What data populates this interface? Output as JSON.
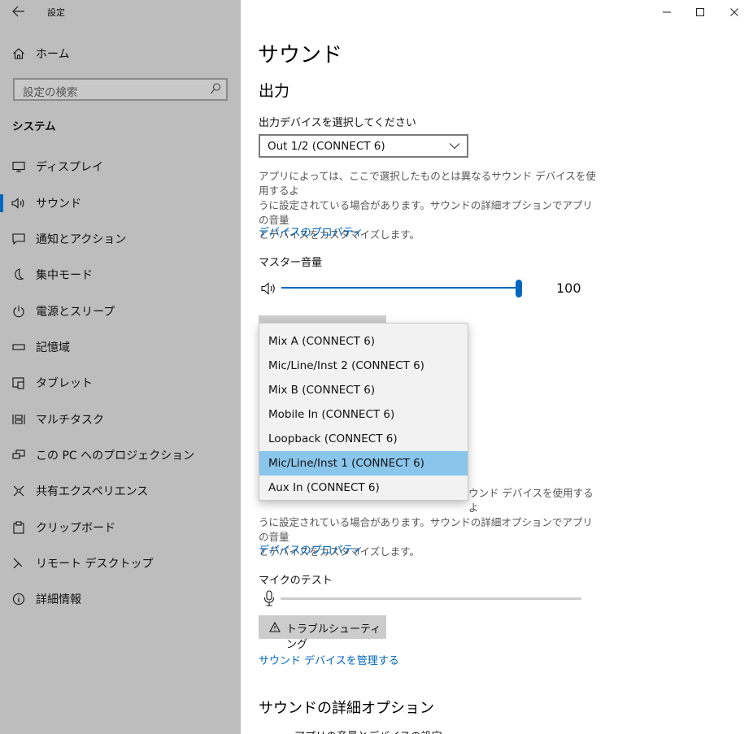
{
  "window": {
    "title": "設定",
    "controls": {
      "minimize": "—",
      "maximize": "☐",
      "close": "✕"
    }
  },
  "sidebar": {
    "home_label": "ホーム",
    "search_placeholder": "設定の検索",
    "section_label": "システム",
    "items": [
      {
        "label": "ディスプレイ",
        "icon": "display-icon"
      },
      {
        "label": "サウンド",
        "icon": "speaker-icon",
        "selected": true
      },
      {
        "label": "通知とアクション",
        "icon": "notification-icon"
      },
      {
        "label": "集中モード",
        "icon": "moon-icon"
      },
      {
        "label": "電源とスリープ",
        "icon": "power-icon"
      },
      {
        "label": "記憶域",
        "icon": "storage-icon"
      },
      {
        "label": "タブレット",
        "icon": "tablet-icon"
      },
      {
        "label": "マルチタスク",
        "icon": "multitask-icon"
      },
      {
        "label": "この PC へのプロジェクション",
        "icon": "projection-icon"
      },
      {
        "label": "共有エクスペリエンス",
        "icon": "shared-experience-icon"
      },
      {
        "label": "クリップボード",
        "icon": "clipboard-icon"
      },
      {
        "label": "リモート デスクトップ",
        "icon": "remote-desktop-icon"
      },
      {
        "label": "詳細情報",
        "icon": "info-icon"
      }
    ],
    "accent_color": "#0067c0"
  },
  "main": {
    "page_title": "サウンド",
    "output": {
      "heading": "出力",
      "select_label": "出力デバイスを選択してください",
      "selected_device": "Out 1/2 (CONNECT 6)",
      "description": "アプリによっては、ここで選択したものとは異なるサウンド デバイスを使用するように設定されている場合があります。サウンドの詳細オプションでアプリの音量とデバイスをカスタマイズします。",
      "desc_line1": "アプリによっては、ここで選択したものとは異なるサウンド デバイスを使用するよ",
      "desc_line2": "うに設定されている場合があります。サウンドの詳細オプションでアプリの音量",
      "desc_line3": "とデバイスをカスタマイズします。",
      "properties_link": "デバイスのプロパティ",
      "master_volume_label": "マスター音量",
      "volume_value": "100",
      "volume_level": 1.0
    },
    "input": {
      "dropdown_options": [
        "Mix A (CONNECT 6)",
        "Mic/Line/Inst 2 (CONNECT 6)",
        "Mix B (CONNECT 6)",
        "Mobile In (CONNECT 6)",
        "Loopback (CONNECT 6)",
        "Mic/Line/Inst 1 (CONNECT 6)",
        "Aux In (CONNECT 6)"
      ],
      "highlighted_option": "Mic/Line/Inst 1 (CONNECT 6)",
      "desc_line1_tail": "ウンド デバイスを使用するよ",
      "desc_line2": "うに設定されている場合があります。サウンドの詳細オプションでアプリの音量",
      "desc_line3": "とデバイスをカスタマイズします。",
      "properties_link": "デバイスのプロパティ",
      "mic_test_label": "マイクのテスト",
      "mic_level": 0,
      "troubleshoot_label": "トラブルシューティング",
      "manage_link": "サウンド デバイスを管理する"
    },
    "advanced_heading": "サウンドの詳細オプション",
    "advanced_item_partial": "アプリの音量とデバイスの設定"
  },
  "colors": {
    "sidebar_bg": "#bdbdbd",
    "link": "#0067c0",
    "slider_fill": "#0067c0",
    "dropdown_highlight": "#8ac5eb"
  }
}
